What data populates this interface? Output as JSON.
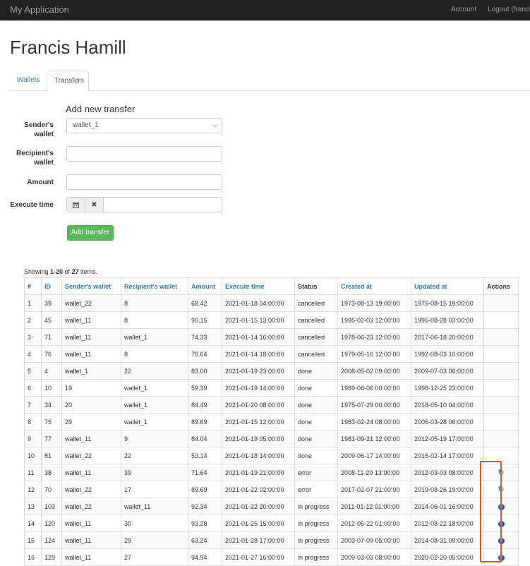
{
  "navbar": {
    "brand": "My Application",
    "account": "Account",
    "logout": "Logout (francis"
  },
  "page_title": "Francis Hamill",
  "tabs": [
    {
      "label": "Wallets"
    },
    {
      "label": "Transfers"
    }
  ],
  "form": {
    "title": "Add new transfer",
    "sender_label": "Sender's wallet",
    "sender_value": "wallet_1",
    "recipient_label": "Recipient's wallet",
    "recipient_value": "",
    "amount_label": "Amount",
    "amount_value": "",
    "execute_label": "Execute time",
    "execute_value": "",
    "submit_label": "Add transfer"
  },
  "summary": {
    "prefix": "Showing ",
    "range": "1-20",
    "of": " of ",
    "total": "27",
    "suffix": " items."
  },
  "table": {
    "headers": [
      "#",
      "ID",
      "Sender's wallet",
      "Recipient's wallet",
      "Amount",
      "Execute time",
      "Status",
      "Created at",
      "Updated at",
      "Actions"
    ],
    "rows": [
      [
        "1",
        "39",
        "wallet_22",
        "8",
        "68.42",
        "2021-01-18 04:00:00",
        "cancelled",
        "1973-08-13 19:00:00",
        "1975-08-15 19:00:00",
        ""
      ],
      [
        "2",
        "45",
        "wallet_11",
        "8",
        "90.15",
        "2021-01-15 13:00:00",
        "cancelled",
        "1995-02-03 12:00:00",
        "1995-08-28 03:00:00",
        ""
      ],
      [
        "3",
        "71",
        "wallet_11",
        "wallet_1",
        "74.33",
        "2021-01-14 16:00:00",
        "cancelled",
        "1978-06-23 12:00:00",
        "2017-06-18 20:00:00",
        ""
      ],
      [
        "4",
        "76",
        "wallet_11",
        "8",
        "76.64",
        "2021-01-14 18:00:00",
        "cancelled",
        "1979-05-16 12:00:00",
        "1992-08-03 10:00:00",
        ""
      ],
      [
        "5",
        "4",
        "wallet_1",
        "22",
        "83.00",
        "2021-01-19 23:00:00",
        "done",
        "2008-05-02 09:00:00",
        "2009-07-03 06:00:00",
        ""
      ],
      [
        "6",
        "10",
        "19",
        "wallet_1",
        "59.39",
        "2021-01-19 14:00:00",
        "done",
        "1989-06-06 00:00:00",
        "1998-12-25 23:00:00",
        ""
      ],
      [
        "7",
        "34",
        "20",
        "wallet_1",
        "84.49",
        "2021-01-20 08:00:00",
        "done",
        "1975-07-29 00:00:00",
        "2018-05-10 04:00:00",
        ""
      ],
      [
        "8",
        "75",
        "29",
        "wallet_1",
        "89.69",
        "2021-01-15 12:00:00",
        "done",
        "1983-02-24 08:00:00",
        "2006-03-28 06:00:00",
        ""
      ],
      [
        "9",
        "77",
        "wallet_11",
        "9",
        "84.04",
        "2021-01-19 05:00:00",
        "done",
        "1981-09-21 12:00:00",
        "2012-05-19 17:00:00",
        ""
      ],
      [
        "10",
        "81",
        "wallet_22",
        "22",
        "53.14",
        "2021-01-18 14:00:00",
        "done",
        "2009-06-17 14:00:00",
        "2016-02-14 17:00:00",
        ""
      ],
      [
        "11",
        "38",
        "wallet_11",
        "39",
        "71.64",
        "2021-01-19 21:00:00",
        "error",
        "2008-11-20 13:00:00",
        "2012-03-03 08:00:00",
        "retry"
      ],
      [
        "12",
        "70",
        "wallet_22",
        "17",
        "89.69",
        "2021-01-22 02:00:00",
        "error",
        "2017-02-07 21:00:00",
        "2019-08-26 19:00:00",
        "retry"
      ],
      [
        "13",
        "103",
        "wallet_22",
        "wallet_11",
        "92.34",
        "2021-01-22 20:00:00",
        "in progress",
        "2011-01-12 01:00:00",
        "2014-06-01 16:00:00",
        "cancel"
      ],
      [
        "14",
        "120",
        "wallet_11",
        "30",
        "93.28",
        "2021-01-25 15:00:00",
        "in progress",
        "2012-05-22 01:00:00",
        "2012-08-22 18:00:00",
        "cancel"
      ],
      [
        "15",
        "124",
        "wallet_11",
        "29",
        "63.24",
        "2021-01-28 17:00:00",
        "in progress",
        "2003-07-09 05:00:00",
        "2014-08-31 09:00:00",
        "cancel"
      ],
      [
        "16",
        "129",
        "wallet_11",
        "27",
        "94.94",
        "2021-01-27 16:00:00",
        "in progress",
        "2009-03-03 08:00:00",
        "2020-02-20 05:00:00",
        "cancel"
      ]
    ]
  },
  "icons": {
    "calendar": "calendar-icon",
    "clear": "clear-icon",
    "retry": "refresh-icon",
    "cancel": "cancel-circle-icon"
  },
  "colors": {
    "highlight": "#e4532c",
    "link": "#337ab7",
    "success": "#5cb85c"
  }
}
